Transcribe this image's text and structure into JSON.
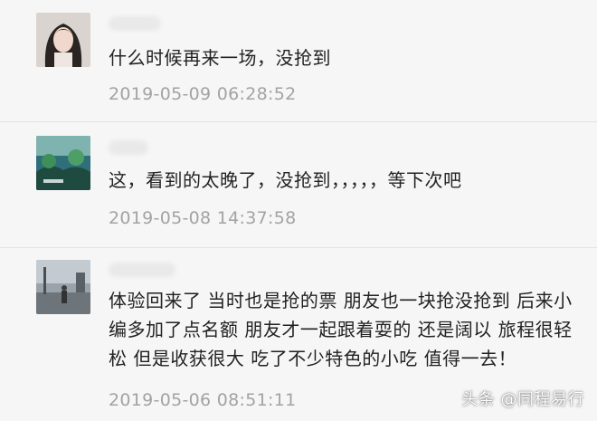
{
  "comments": [
    {
      "username": "用户",
      "text": "什么时候再来一场，没抢到",
      "timestamp": "2019-05-09 06:28:52",
      "avatar_icon": "girl-portrait-avatar"
    },
    {
      "username": "用户",
      "text": "这，看到的太晚了，没抢到，，，，，等下次吧",
      "timestamp": "2019-05-08 14:37:58",
      "avatar_icon": "green-scenery-avatar"
    },
    {
      "username": "用户",
      "text": "体验回来了 当时也是抢的票 朋友也一块抢没抢到 后来小编多加了点名额 朋友才一起跟着耍的 还是阔以 旅程很轻松 但是收获很大 吃了不少特色的小吃 值得一去！",
      "timestamp": "2019-05-06 08:51:11",
      "avatar_icon": "rainy-street-avatar"
    }
  ],
  "watermark": "头条 @同程易行",
  "colors": {
    "background": "#f6f6f6",
    "text": "#222222",
    "timestamp": "#a3a3a3",
    "divider": "#e4e4e4"
  }
}
